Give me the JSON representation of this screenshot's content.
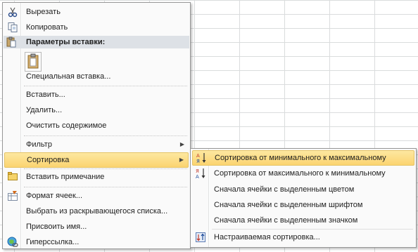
{
  "main_menu": {
    "cut": "Вырезать",
    "copy": "Копировать",
    "paste_options_header": "Параметры вставки:",
    "paste_special": "Специальная вставка...",
    "insert": "Вставить...",
    "delete": "Удалить...",
    "clear_contents": "Очистить содержимое",
    "filter": "Фильтр",
    "sort": "Сортировка",
    "insert_comment": "Вставить примечание",
    "format_cells": "Формат ячеек...",
    "pick_from_list": "Выбрать из раскрывающегося списка...",
    "define_name": "Присвоить имя...",
    "hyperlink": "Гиперссылка..."
  },
  "sort_submenu": {
    "asc": "Сортировка от минимального к максимальному",
    "desc": "Сортировка от максимального к минимальному",
    "cell_color_first": "Сначала ячейки с выделенным цветом",
    "font_color_first": "Сначала ячейки с выделенным шрифтом",
    "icon_first": "Сначала ячейки с выделенным значком",
    "custom_sort": "Настраиваемая сортировка..."
  },
  "colors": {
    "highlight_top": "#fde8a0",
    "highlight_bottom": "#fbd470",
    "header_bg": "#dde1e6"
  }
}
